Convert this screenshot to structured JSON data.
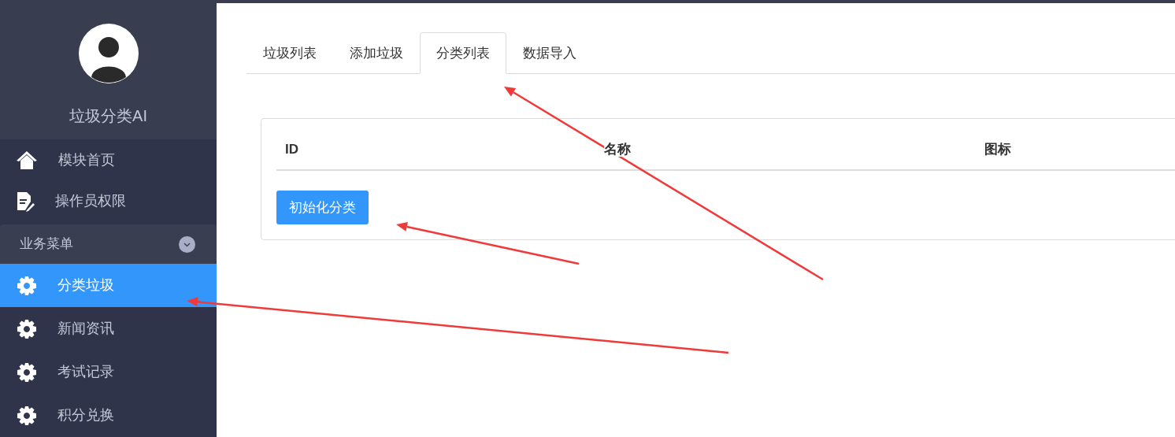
{
  "sidebar": {
    "brand": "垃圾分类AI",
    "nav_items": [
      {
        "label": "模块首页",
        "selected": false
      },
      {
        "label": "操作员权限",
        "selected": false
      }
    ],
    "group": {
      "label": "业务菜单",
      "expanded": true,
      "items": [
        {
          "label": "分类垃圾",
          "selected": true
        },
        {
          "label": "新闻资讯",
          "selected": false
        },
        {
          "label": "考试记录",
          "selected": false
        },
        {
          "label": "积分兑换",
          "selected": false
        }
      ]
    }
  },
  "tabs": [
    {
      "label": "垃圾列表",
      "selected": false
    },
    {
      "label": "添加垃圾",
      "selected": false
    },
    {
      "label": "分类列表",
      "selected": true
    },
    {
      "label": "数据导入",
      "selected": false
    }
  ],
  "table": {
    "columns": [
      "ID",
      "名称",
      "图标"
    ]
  },
  "init_button": "初始化分类"
}
